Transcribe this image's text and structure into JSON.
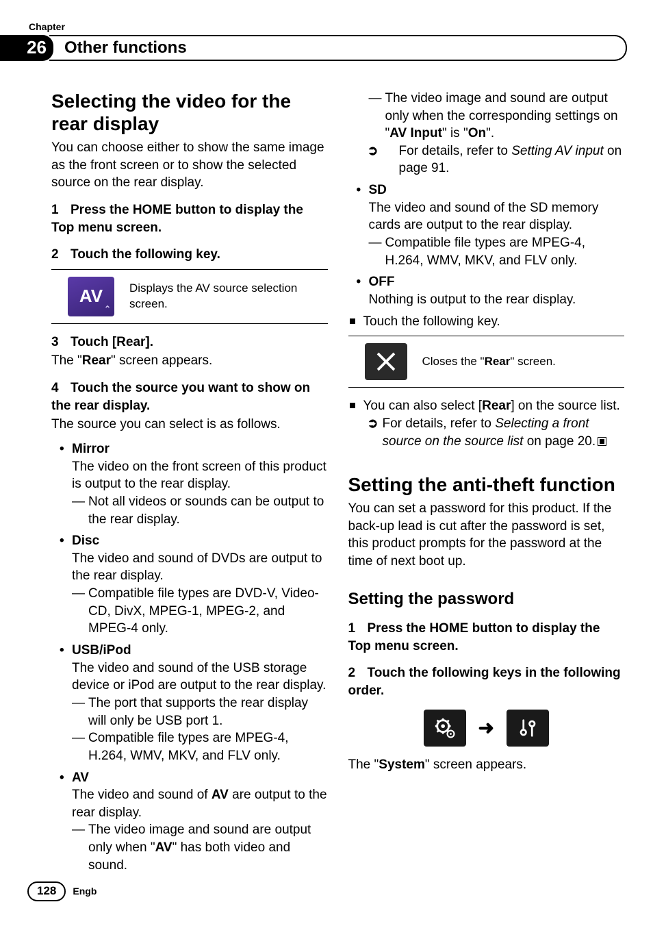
{
  "header": {
    "chapter_word": "Chapter",
    "chapter_num": "26",
    "chapter_title": "Other functions"
  },
  "left": {
    "h1": "Selecting the video for the rear display",
    "intro": "You can choose either to show the same image as the front screen or to show the selected source on the rear display.",
    "step1": {
      "n": "1",
      "t": "Press the HOME button to display the Top menu screen."
    },
    "step2": {
      "n": "2",
      "t": "Touch the following key."
    },
    "av_tile_label": "AV",
    "av_tile_sub": "⌃",
    "av_desc": "Displays the AV source selection screen.",
    "step3": {
      "n": "3",
      "t": "Touch [Rear]."
    },
    "step3_after_a": "The \"",
    "step3_bold": "Rear",
    "step3_after_b": "\" screen appears.",
    "step4": {
      "n": "4",
      "t": "Touch the source you want to show on the rear display."
    },
    "step4_after": "The source you can select is as follows.",
    "mirror_t": "Mirror",
    "mirror_b": "The video on the front screen of this product is output to the rear display.",
    "mirror_d": "Not all videos or sounds can be output to the rear display.",
    "disc_t": "Disc",
    "disc_b": "The video and sound of DVDs are output to the rear display.",
    "disc_d": "Compatible file types are DVD-V, Video-CD, DivX, MPEG-1, MPEG-2, and MPEG-4 only.",
    "usb_t": "USB/iPod",
    "usb_b": "The video and sound of the USB storage device or iPod are output to the rear display.",
    "usb_d1": "The port that supports the rear display will only be USB port 1.",
    "usb_d2": "Compatible file types are MPEG-4, H.264, WMV, MKV, and FLV only.",
    "av_t": "AV",
    "av_b_a": "The video and sound of ",
    "av_b_bold": "AV",
    "av_b_b": " are output to the rear display.",
    "av_d1_a": "The video image and sound are output only when \"",
    "av_d1_bold": "AV",
    "av_d1_b": "\" has both video and sound."
  },
  "right": {
    "av_d2_a": "The video image and sound are output only when the corresponding settings on \"",
    "av_d2_bold1": "AV Input",
    "av_d2_mid": "\" is \"",
    "av_d2_bold2": "On",
    "av_d2_b": "\".",
    "av_ref_a": "For details, refer to ",
    "av_ref_i": "Setting AV input",
    "av_ref_b": " on page 91.",
    "sd_t": "SD",
    "sd_b": "The video and sound of the SD memory cards are output to the rear display.",
    "sd_d": "Compatible file types are MPEG-4, H.264, WMV, MKV, and FLV only.",
    "off_t": "OFF",
    "off_b": "Nothing is output to the rear display.",
    "touch_key": "Touch the following key.",
    "close_desc_a": "Closes the \"",
    "close_desc_bold": "Rear",
    "close_desc_b": "\" screen.",
    "also_a": "You can also select [",
    "also_bold": "Rear",
    "also_b": "] on the source list.",
    "also_ref_a": "For details, refer to ",
    "also_ref_i": "Selecting a front source on the source list",
    "also_ref_b": " on page 20.",
    "h2": "Setting the anti-theft function",
    "h2_body": "You can set a password for this product. If the back-up lead is cut after the password is set, this product prompts for the password at the time of next boot up.",
    "sub": "Setting the password",
    "p_step1": {
      "n": "1",
      "t": "Press the HOME button to display the Top menu screen."
    },
    "p_step2": {
      "n": "2",
      "t": "Touch the following keys in the following order."
    },
    "sys_a": "The \"",
    "sys_bold": "System",
    "sys_b": "\" screen appears."
  },
  "footer": {
    "page": "128",
    "lang": "Engb"
  }
}
